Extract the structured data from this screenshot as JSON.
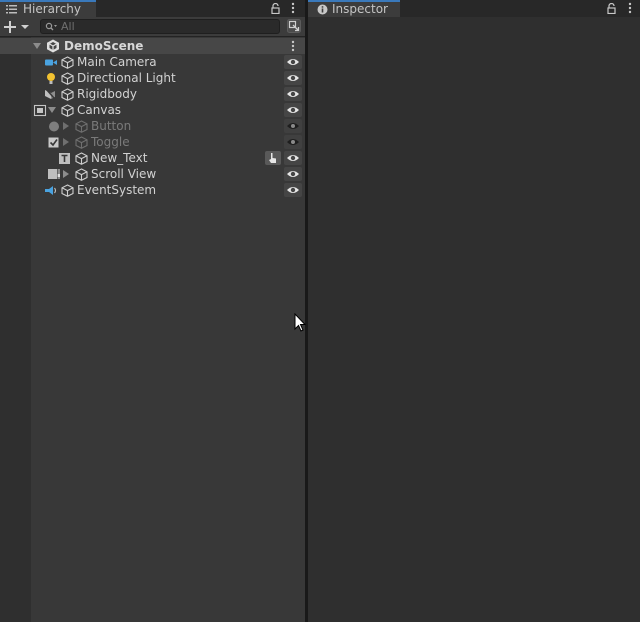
{
  "hierarchy": {
    "tab_label": "Hierarchy",
    "tab_icon": "list-icon",
    "search": {
      "placeholder": "All",
      "value": ""
    },
    "scene": {
      "name": "DemoScene"
    },
    "items": [
      {
        "name": "Main Camera",
        "icon": "camera-icon",
        "depth": 0,
        "expandable": false,
        "active": true
      },
      {
        "name": "Directional Light",
        "icon": "light-icon",
        "depth": 0,
        "expandable": false,
        "active": true
      },
      {
        "name": "Rigidbody",
        "icon": "rigidbody-icon",
        "depth": 0,
        "expandable": false,
        "active": true
      },
      {
        "name": "Canvas",
        "icon": "canvas-icon",
        "depth": 0,
        "expandable": true,
        "expanded": true,
        "active": true
      },
      {
        "name": "Button",
        "icon": "button-icon",
        "depth": 1,
        "expandable": true,
        "active": false
      },
      {
        "name": "Toggle",
        "icon": "toggle-icon",
        "depth": 1,
        "expandable": true,
        "active": false
      },
      {
        "name": "New_Text",
        "icon": "text-icon",
        "depth": 1,
        "expandable": false,
        "active": true,
        "pickable_toggle": true
      },
      {
        "name": "Scroll View",
        "icon": "scrollview-icon",
        "depth": 1,
        "expandable": true,
        "active": true
      },
      {
        "name": "EventSystem",
        "icon": "eventsystem-icon",
        "depth": 0,
        "expandable": false,
        "active": true
      }
    ]
  },
  "inspector": {
    "tab_label": "Inspector",
    "tab_icon": "info-icon"
  },
  "colors": {
    "panel_bg": "#383838",
    "tab_accent": "#3a79bb",
    "text": "#d2d2d2",
    "inactive_text": "#7a7a7a"
  }
}
